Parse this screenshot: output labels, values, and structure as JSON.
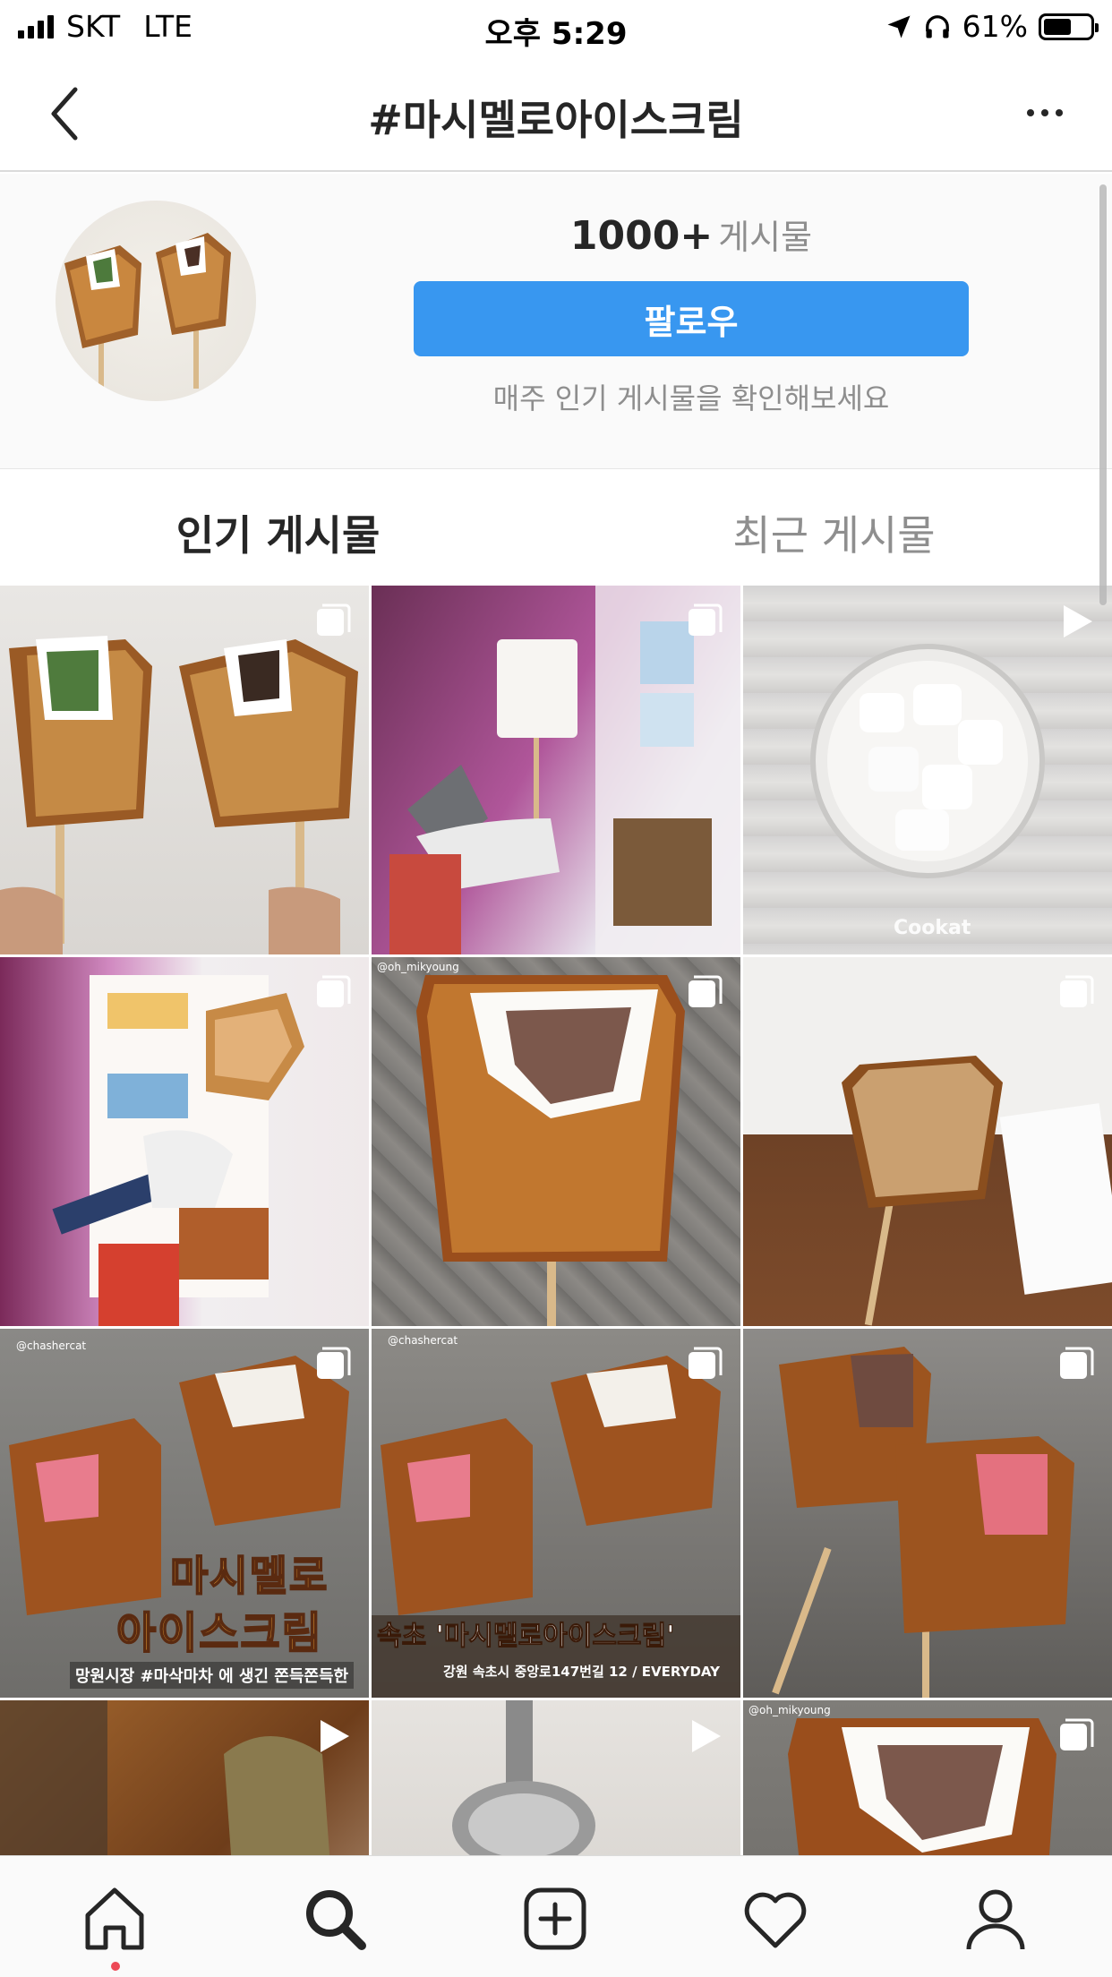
{
  "status_bar": {
    "carrier": "SKT",
    "network": "LTE",
    "time": "오후 5:29",
    "battery": "61%"
  },
  "nav": {
    "title": "#마시멜로아이스크림"
  },
  "header": {
    "post_count": "1000+",
    "post_count_label": "게시물",
    "follow_label": "팔로우",
    "hint": "매주 인기 게시물을 확인해보세요"
  },
  "tabs": {
    "top": "인기 게시물",
    "recent": "최근 게시물"
  },
  "grid": {
    "posts": [
      {
        "badge": "multiple-icon"
      },
      {
        "badge": "multiple-icon"
      },
      {
        "badge": "video-icon",
        "watermark": "Cookat"
      },
      {
        "badge": "multiple-icon"
      },
      {
        "badge": "multiple-icon",
        "watermark": "@oh_mikyoung"
      },
      {
        "badge": "multiple-icon"
      },
      {
        "badge": "multiple-icon",
        "watermark": "@chashercat",
        "caption_line1": "마시멜로",
        "caption_line2": "아이스크림",
        "caption_sub": "망원시장 #마삭마차 에 생긴 쫀득쫀득한"
      },
      {
        "badge": "multiple-icon",
        "watermark": "@chashercat",
        "caption_line1": "속초 '마시멜로아이스크림'",
        "caption_sub": "강원 속초시 중앙로147번길 12 / EVERYDAY"
      },
      {
        "badge": "multiple-icon"
      },
      {
        "badge": "video-icon"
      },
      {
        "badge": "video-icon"
      },
      {
        "badge": "multiple-icon",
        "watermark": "@oh_mikyoung"
      }
    ]
  },
  "colors": {
    "accent": "#3897f0",
    "muted": "#8e8e8e",
    "text": "#262626",
    "notification_dot": "#ed4956"
  }
}
